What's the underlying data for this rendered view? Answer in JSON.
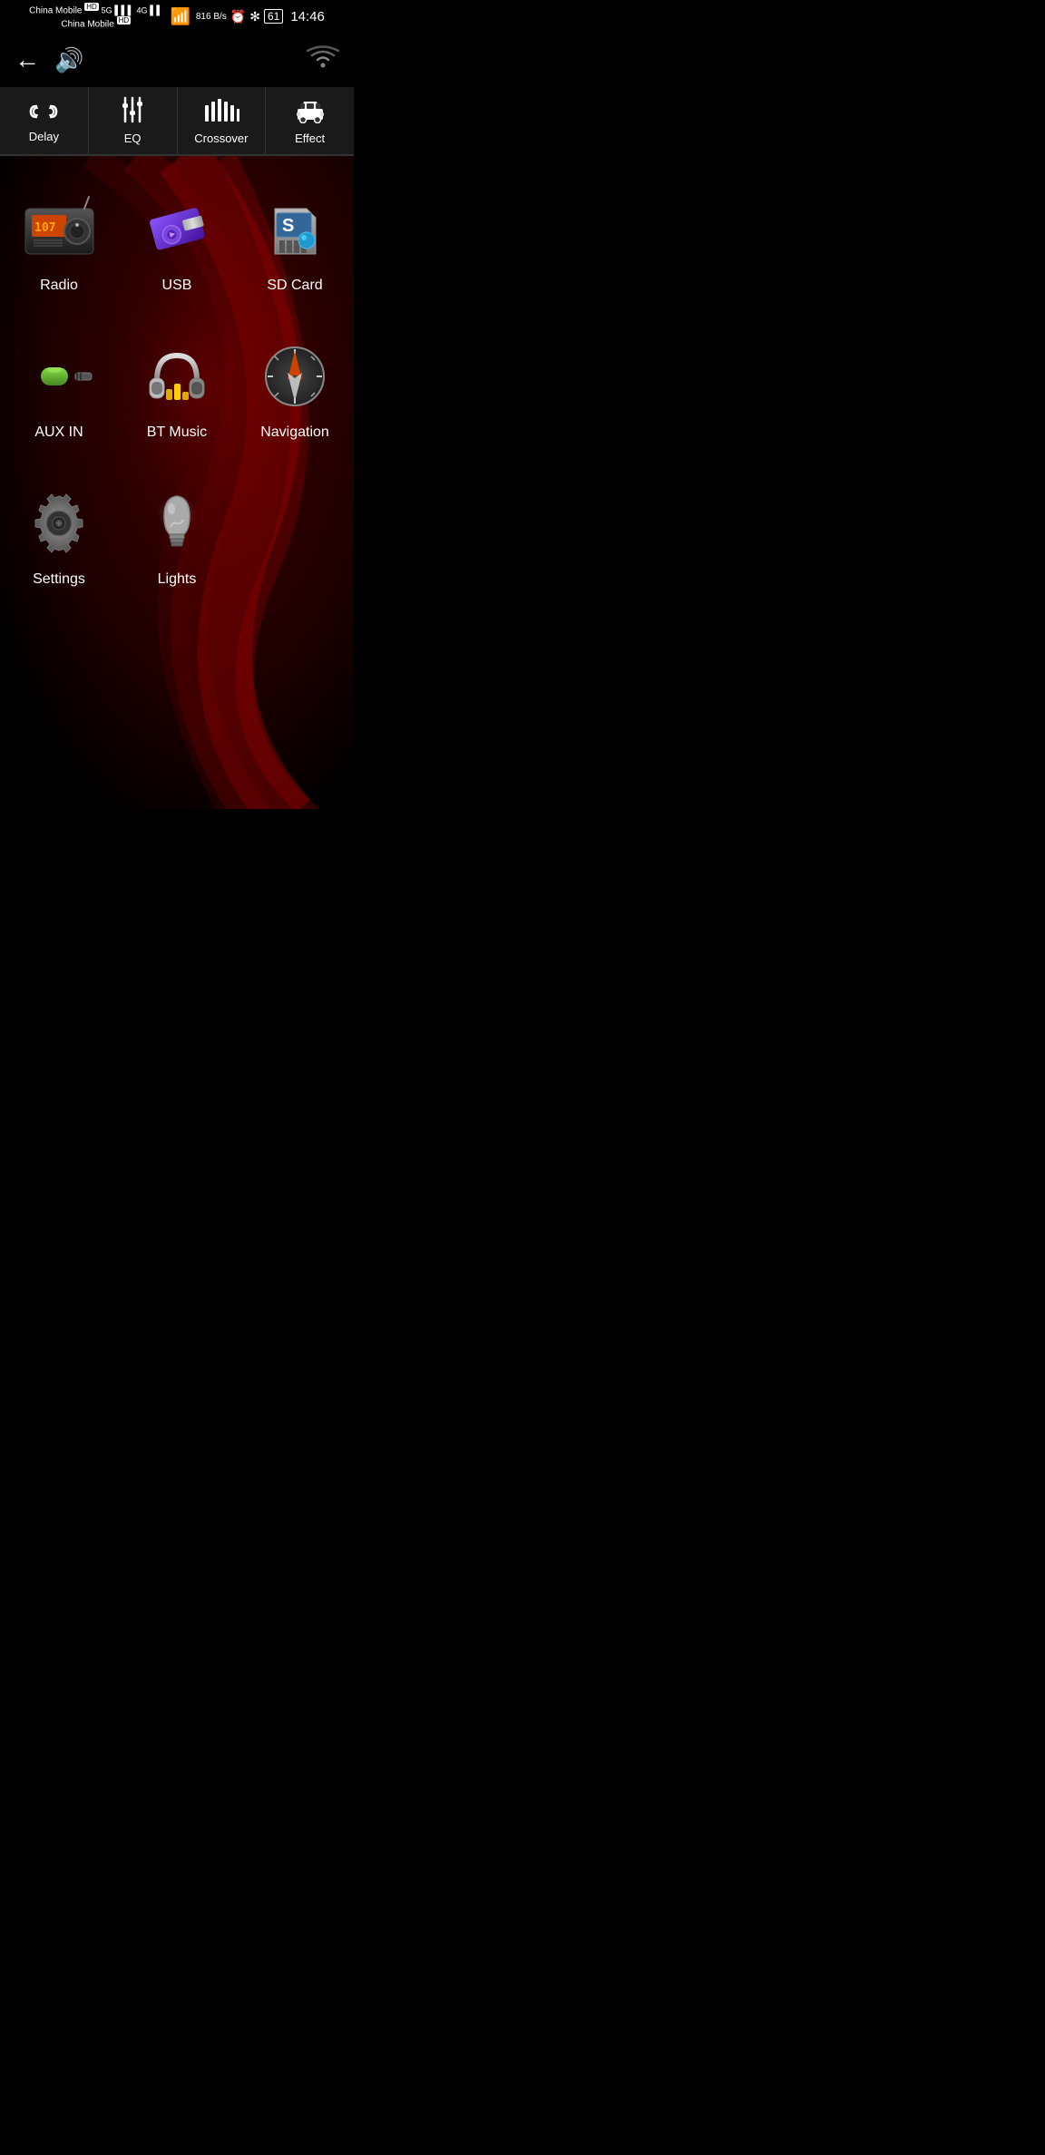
{
  "statusBar": {
    "carrier1": "China Mobile",
    "carrier1Badge": "HD",
    "carrier1Network": "5G",
    "carrier2": "China Mobile",
    "carrier2Badge": "HD",
    "speed": "816 B/s",
    "time": "14:46",
    "battery": "61"
  },
  "topNav": {
    "backIcon": "←",
    "volumeIcon": "🔊"
  },
  "tabs": [
    {
      "id": "delay",
      "label": "Delay",
      "icon": "delay"
    },
    {
      "id": "eq",
      "label": "EQ",
      "icon": "eq"
    },
    {
      "id": "crossover",
      "label": "Crossover",
      "icon": "crossover"
    },
    {
      "id": "effect",
      "label": "Effect",
      "icon": "effect"
    }
  ],
  "apps": [
    {
      "id": "radio",
      "label": "Radio"
    },
    {
      "id": "usb",
      "label": "USB"
    },
    {
      "id": "sdcard",
      "label": "SD Card"
    },
    {
      "id": "auxin",
      "label": "AUX IN"
    },
    {
      "id": "btmusic",
      "label": "BT Music"
    },
    {
      "id": "navigation",
      "label": "Navigation"
    },
    {
      "id": "settings",
      "label": "Settings"
    },
    {
      "id": "lights",
      "label": "Lights"
    }
  ]
}
